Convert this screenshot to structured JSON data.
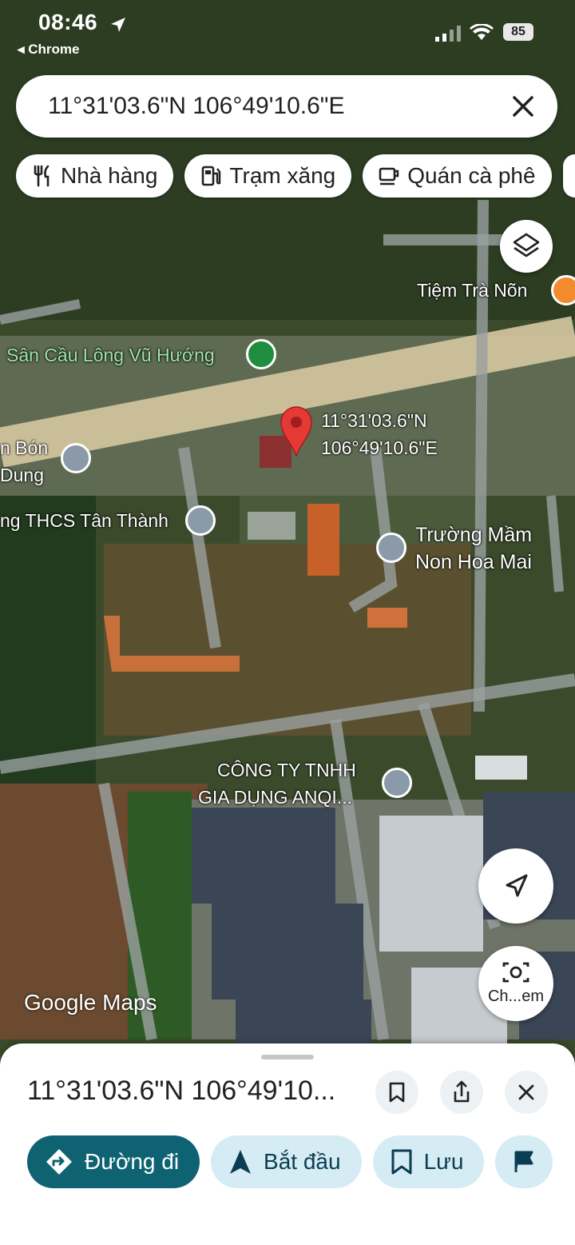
{
  "status_bar": {
    "time": "08:46",
    "back_app": "◂ Chrome",
    "battery": "85"
  },
  "search": {
    "value": "11°31'03.6\"N 106°49'10.6\"E"
  },
  "chips": [
    "Nhà hàng",
    "Trạm xăng",
    "Quán cà phê"
  ],
  "map_labels": {
    "tiem_tra": "Tiệm Trà Nõn",
    "san_cau_long": "Sân Cầu Lông Vũ Hướng",
    "bon_dung_1": "n Bón",
    "bon_dung_2": "Dung",
    "thcs": "ng THCS Tân Thành",
    "pin_line1": "11°31'03.6\"N",
    "pin_line2": "106°49'10.6\"E",
    "mam_non_1": "Trường Mầm",
    "mam_non_2": "Non Hoa Mai",
    "cong_ty_1": "CÔNG TY TNHH",
    "cong_ty_2": "GIA DỤNG ANQI...",
    "camera_label": "Ch...em"
  },
  "logo": "Google Maps",
  "sheet": {
    "title": "11°31'03.6\"N 106°49'10...",
    "actions": [
      "Đường đi",
      "Bắt đầu",
      "Lưu"
    ]
  },
  "colors": {
    "primary": "#0e6272",
    "secondary": "#d6ecf4",
    "pin": "#e53935",
    "poi_green": "#1e8e3e",
    "poi_gray": "#8a9aa8"
  }
}
